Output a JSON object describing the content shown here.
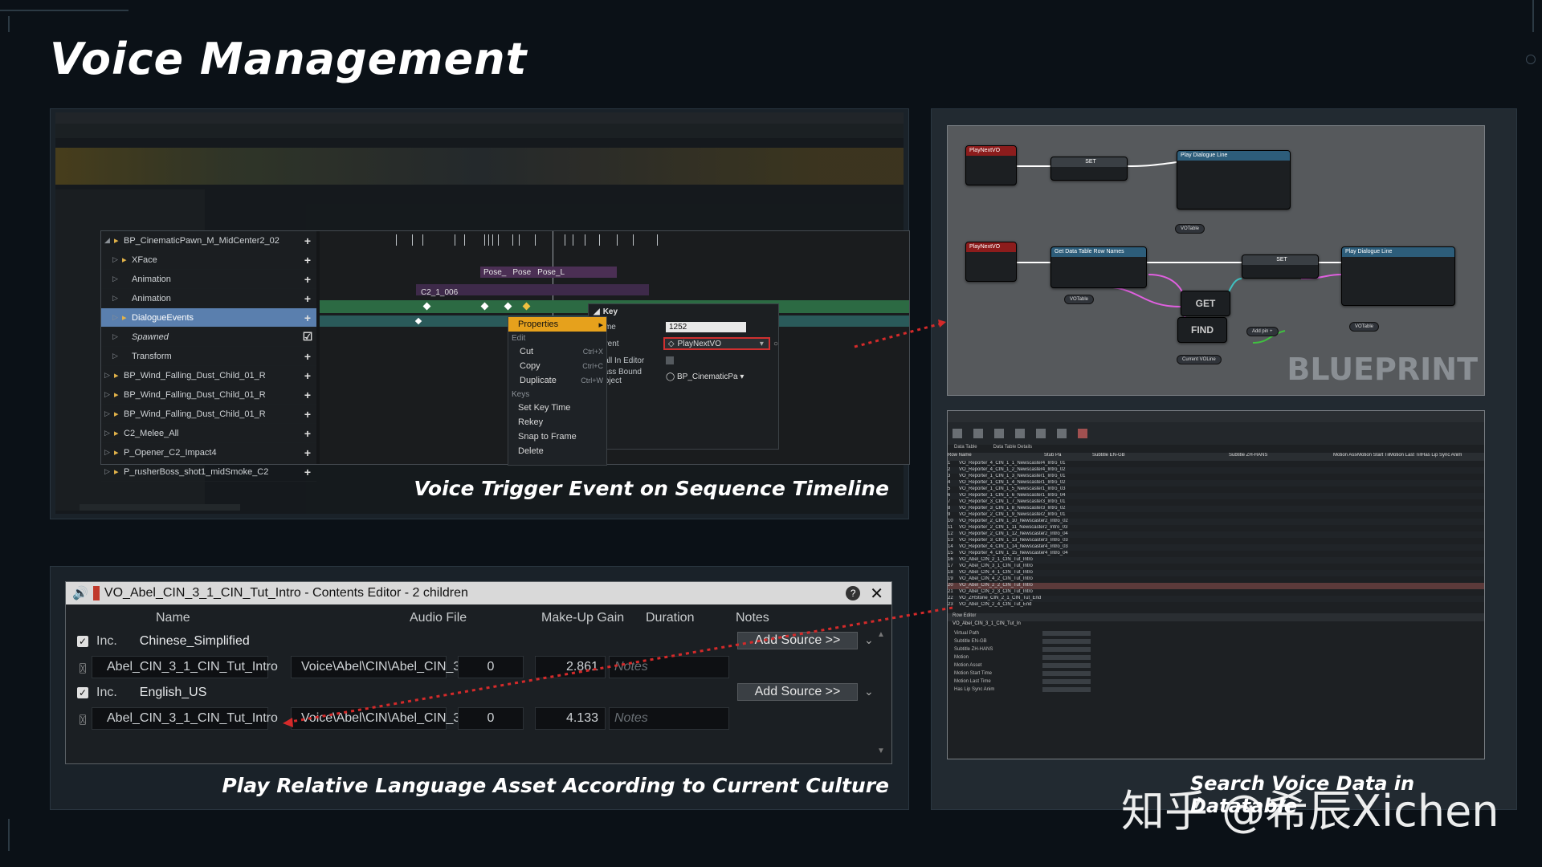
{
  "page": {
    "title": "Voice Management",
    "watermark": "知乎 @希辰Xichen"
  },
  "captions": {
    "sequence": "Voice Trigger Event on Sequence Timeline",
    "culture": "Play Relative Language Asset According to Current Culture",
    "datatable": "Search Voice Data in Datatable",
    "blueprint": "BLUEPRINT"
  },
  "sequencer": {
    "tracks": [
      {
        "label": "BP_CinematicPawn_M_MidCenter2_02",
        "icon": "pawn-icon"
      },
      {
        "label": "XFace",
        "icon": "face-icon"
      },
      {
        "label": "Animation",
        "icon": ""
      },
      {
        "label": "Animation",
        "icon": ""
      },
      {
        "label": "DialogueEvents",
        "icon": "flag-icon"
      },
      {
        "label": "Spawned",
        "icon": ""
      },
      {
        "label": "Transform",
        "icon": ""
      },
      {
        "label": "BP_Wind_Falling_Dust_Child_01_R",
        "icon": "actor-icon"
      },
      {
        "label": "BP_Wind_Falling_Dust_Child_01_R",
        "icon": "actor-icon"
      },
      {
        "label": "BP_Wind_Falling_Dust_Child_01_R",
        "icon": "actor-icon"
      },
      {
        "label": "C2_Melee_All",
        "icon": "fx-icon"
      },
      {
        "label": "P_Opener_C2_Impact4",
        "icon": "fx-icon"
      },
      {
        "label": "P_rusherBoss_shot1_midSmoke_C2",
        "icon": "fx-icon"
      }
    ],
    "clip_label": "C2_1_006",
    "section_labels": [
      "Pose_",
      "Pose",
      "Pose_L"
    ],
    "context_menu": {
      "properties": "Properties",
      "edit_header": "Edit",
      "items_edit": [
        {
          "label": "Cut",
          "shortcut": "Ctrl+X"
        },
        {
          "label": "Copy",
          "shortcut": "Ctrl+C"
        },
        {
          "label": "Duplicate",
          "shortcut": "Ctrl+W"
        }
      ],
      "keys_header": "Keys",
      "items_keys": [
        "Set Key Time",
        "Rekey",
        "Snap to Frame",
        "Delete"
      ]
    },
    "key_panel": {
      "header": "Key",
      "time_label": "Time",
      "time_value": "1252",
      "event_label": "Event",
      "event_value": "PlayNextVO",
      "call_in_editor_label": "Call In Editor",
      "pass_bound_label": "Pass Bound Object",
      "pass_bound_value": "BP_CinematicPa"
    }
  },
  "contents_editor": {
    "title": "VO_Abel_CIN_3_1_CIN_Tut_Intro - Contents Editor - 2 children",
    "columns": [
      "Name",
      "Audio File",
      "Make-Up Gain",
      "Duration",
      "Notes"
    ],
    "groups": [
      {
        "inc_label": "Inc.",
        "culture": "Chinese_Simplified",
        "add_source": "Add Source >>",
        "item_name": "Abel_CIN_3_1_CIN_Tut_Intro",
        "audio_file": "Voice\\Abel\\CIN\\Abel_CIN_3...",
        "gain": "0",
        "duration": "2.861",
        "notes_placeholder": "Notes"
      },
      {
        "inc_label": "Inc.",
        "culture": "English_US",
        "add_source": "Add Source >>",
        "item_name": "Abel_CIN_3_1_CIN_Tut_Intro",
        "audio_file": "Voice\\Abel\\CIN\\Abel_CIN_3...",
        "gain": "0",
        "duration": "4.133",
        "notes_placeholder": "Notes"
      }
    ]
  },
  "blueprint": {
    "nodes": {
      "event1": "PlayNextVO",
      "set1": "SET",
      "play1": "Play Dialogue Line",
      "event2": "PlayNextVO",
      "getrows": "Get Data Table Row Names",
      "set2": "SET",
      "play2": "Play Dialogue Line",
      "get": "GET",
      "find": "FIND"
    },
    "pills": [
      "VOTable",
      "VOTable",
      "VOTable",
      "Current VOLine",
      "Add pin +"
    ]
  },
  "datatable": {
    "tabs": [
      "Data Table",
      "Data Table Details"
    ],
    "columns": [
      "Row Name",
      "Stub Pa",
      "Subtitle EN-GB",
      "Subtitle ZH-HANS",
      "Motion Asset",
      "Motion Start Time",
      "Motion Last Time",
      "Has Lip Sync Anim"
    ],
    "rows": [
      "VO_Reporter_4_CIN_1_1_Newscaster4_Intro_01",
      "VO_Reporter_4_CIN_1_2_Newscaster4_Intro_02",
      "VO_Reporter_1_CIN_1_3_Newscaster1_Intro_01",
      "VO_Reporter_1_CIN_1_4_Newscaster1_Intro_02",
      "VO_Reporter_1_CIN_1_5_Newscaster1_Intro_03",
      "VO_Reporter_1_CIN_1_6_Newscaster1_Intro_04",
      "VO_Reporter_3_CIN_1_7_Newscaster3_Intro_01",
      "VO_Reporter_3_CIN_1_8_Newscaster3_Intro_02",
      "VO_Reporter_2_CIN_1_9_Newscaster2_Intro_01",
      "VO_Reporter_2_CIN_1_10_Newscaster2_Intro_02",
      "VO_Reporter_2_CIN_1_11_Newscaster2_Intro_03",
      "VO_Reporter_2_CIN_1_12_Newscaster2_Intro_04",
      "VO_Reporter_3_CIN_1_13_Newscaster3_Intro_03",
      "VO_Reporter_4_CIN_1_14_Newscaster4_Intro_03",
      "VO_Reporter_4_CIN_1_15_Newscaster4_Intro_04",
      "VO_Abel_CIN_2_1_CIN_Tut_Intro",
      "VO_Abel_CIN_3_1_CIN_Tut_Intro",
      "VO_Abel_CIN_4_1_CIN_Tut_Intro",
      "VO_Abel_CIN_4_2_CIN_Tut_Intro",
      "VO_Abel_CIN_2_2_CIN_Tut_Intro",
      "VO_Abel_CIN_2_3_CIN_Tut_Intro",
      "VO_ZHStone_CIN_2_1_CIN_Tut_End",
      "VO_Abel_CIN_2_4_CIN_Tut_End"
    ],
    "row_editor": "Row Editor",
    "row_label": "VO_Abel_CIN_3_1_CIN_Tut_In",
    "details": [
      "Virtual Path",
      "Subtitle EN-GB",
      "Subtitle ZH-HANS",
      "Motion",
      "Motion Asset",
      "Motion Start Time",
      "Motion Last Time",
      "Has Lip Sync Anim"
    ]
  }
}
